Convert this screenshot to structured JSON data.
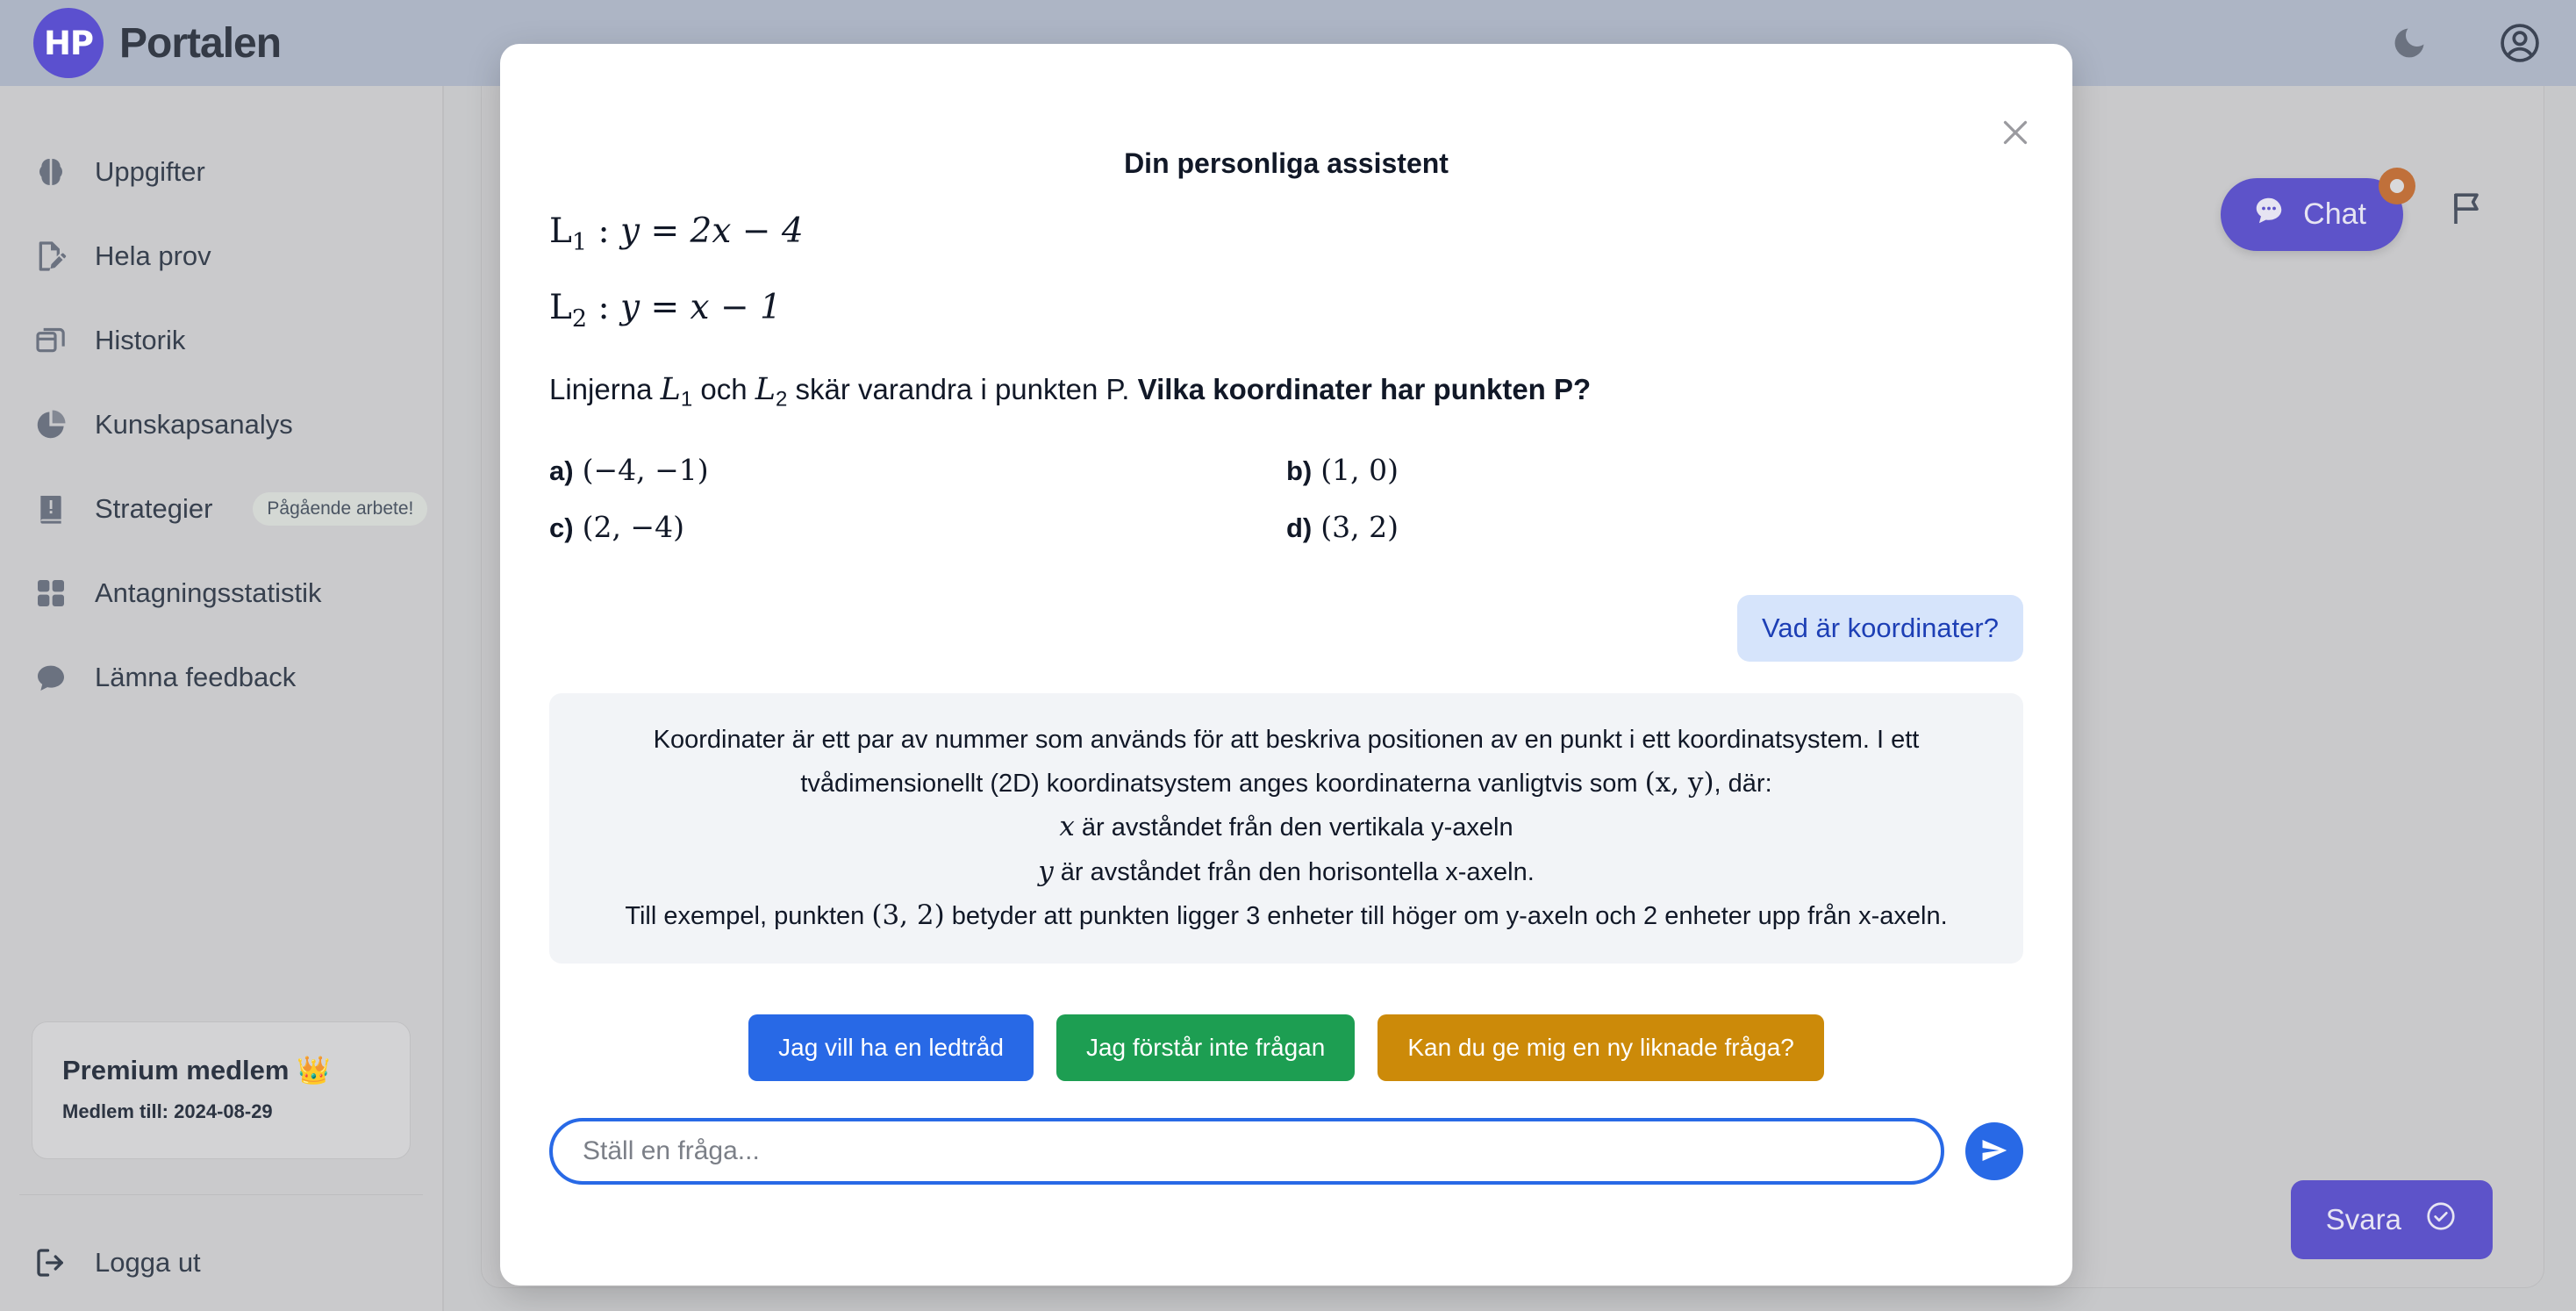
{
  "header": {
    "logo_text": "HP",
    "brand_name": "Portalen",
    "dark_mode_icon": "moon-icon",
    "account_icon": "account-circle-icon"
  },
  "sidebar": {
    "items": [
      {
        "label": "Uppgifter",
        "icon": "brain-icon"
      },
      {
        "label": "Hela prov",
        "icon": "exam-pencil-icon"
      },
      {
        "label": "Historik",
        "icon": "history-window-icon"
      },
      {
        "label": "Kunskapsanalys",
        "icon": "pie-chart-icon"
      },
      {
        "label": "Strategier",
        "icon": "book-icon",
        "badge": "Pågående arbete!"
      },
      {
        "label": "Antagningsstatistik",
        "icon": "grid-squares-icon"
      },
      {
        "label": "Lämna feedback",
        "icon": "chat-bubble-icon"
      }
    ],
    "premium": {
      "title": "Premium medlem 👑",
      "valid_until": "Medlem till: 2024-08-29"
    },
    "logout": {
      "label": "Logga ut",
      "icon": "logout-icon"
    }
  },
  "main": {
    "chat_fab": {
      "label": "Chat",
      "icon": "chat-dots-icon",
      "badge": "notification-dot"
    },
    "flag_button": {
      "icon": "flag-icon"
    },
    "answer_button": {
      "label": "Svara",
      "icon": "check-circle-icon"
    }
  },
  "modal": {
    "title": "Din personliga assistent",
    "close_icon": "close-icon",
    "equations": [
      {
        "name": "L",
        "sub": "1",
        "rhs": "y = 2x − 4"
      },
      {
        "name": "L",
        "sub": "2",
        "rhs": "y = x − 1"
      }
    ],
    "question": {
      "part1": "Linjerna ",
      "var1": "L",
      "var1_sub": "1",
      "part2": " och ",
      "var2": "L",
      "var2_sub": "2",
      "part3": " skär varandra i punkten P. ",
      "bold": "Vilka koordinater har punkten P?"
    },
    "options": [
      {
        "label": "a)",
        "value": "(−4, −1)"
      },
      {
        "label": "b)",
        "value": "(1, 0)"
      },
      {
        "label": "c)",
        "value": "(2, −4)"
      },
      {
        "label": "d)",
        "value": "(3, 2)"
      }
    ],
    "messages": [
      {
        "role": "user",
        "text": "Vad är koordinater?"
      }
    ],
    "assistant_answer": {
      "line1": "Koordinater är ett par av nummer som används för att beskriva positionen av en punkt i ett koordinatsystem. I ett tvådimensionellt (2D) koordinatsystem anges koordinaterna vanligtvis som ",
      "tuple1": "(x, y)",
      "line1_end": ", där:",
      "line2_var": "x",
      "line2": " är avståndet från den vertikala y-axeln",
      "line3_var": "y",
      "line3": " är avståndet från den horisontella x-axeln.",
      "line4_start": "Till exempel, punkten ",
      "tuple2": "(3, 2)",
      "line4_end": " betyder att punkten ligger 3 enheter till höger om y-axeln och 2 enheter upp från x-axeln."
    },
    "quick_actions": [
      {
        "label": "Jag vill ha en ledtråd",
        "color": "#2869e6"
      },
      {
        "label": "Jag förstår inte frågan",
        "color": "#1d9e52"
      },
      {
        "label": "Kan du ge mig en ny liknade fråga?",
        "color": "#cc8a09"
      }
    ],
    "composer": {
      "placeholder": "Ställ en fråga...",
      "value": "",
      "send_icon": "send-paper-plane-icon"
    }
  }
}
